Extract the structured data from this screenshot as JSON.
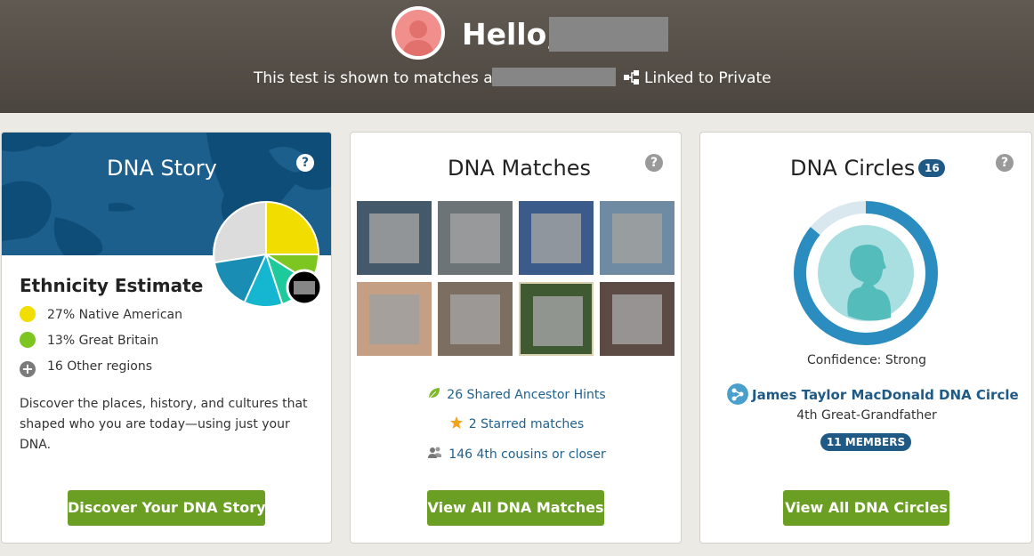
{
  "header": {
    "greeting": "Hello,",
    "shown_as_text": "This test is shown to matches as",
    "linked_text": "Linked to Private"
  },
  "story": {
    "title": "DNA Story",
    "ethnicity_title": "Ethnicity Estimate",
    "regions": [
      {
        "label": "27% Native American",
        "color": "#f1dd00"
      },
      {
        "label": "13% Great Britain",
        "color": "#7dc622"
      }
    ],
    "other_label": "16 Other regions",
    "description": "Discover the places, history, and cultures that shaped who you are today—using just your DNA.",
    "button": "Discover Your DNA Story",
    "pie_colors": [
      "#f1dd00",
      "#7dc622",
      "#1ec99b",
      "#14b7cf",
      "#1a8db5",
      "#dcdcdc"
    ]
  },
  "matches": {
    "title": "DNA Matches",
    "stats": [
      {
        "label": "26 Shared Ancestor Hints",
        "icon": "leaf-icon"
      },
      {
        "label": "2 Starred matches",
        "icon": "star-icon"
      },
      {
        "label": "146 4th cousins or closer",
        "icon": "people-icon"
      }
    ],
    "button": "View All DNA Matches"
  },
  "circles": {
    "title": "DNA Circles",
    "count": "16",
    "confidence": "Confidence: Strong",
    "circle_name": "James Taylor MacDonald DNA Circle",
    "relationship": "4th Great-Grandfather",
    "members": "11 MEMBERS",
    "button": "View All DNA Circles"
  },
  "colors": {
    "accent_green": "#6b9f23",
    "link_blue": "#21618c",
    "brand_blue": "#1f5a86"
  }
}
